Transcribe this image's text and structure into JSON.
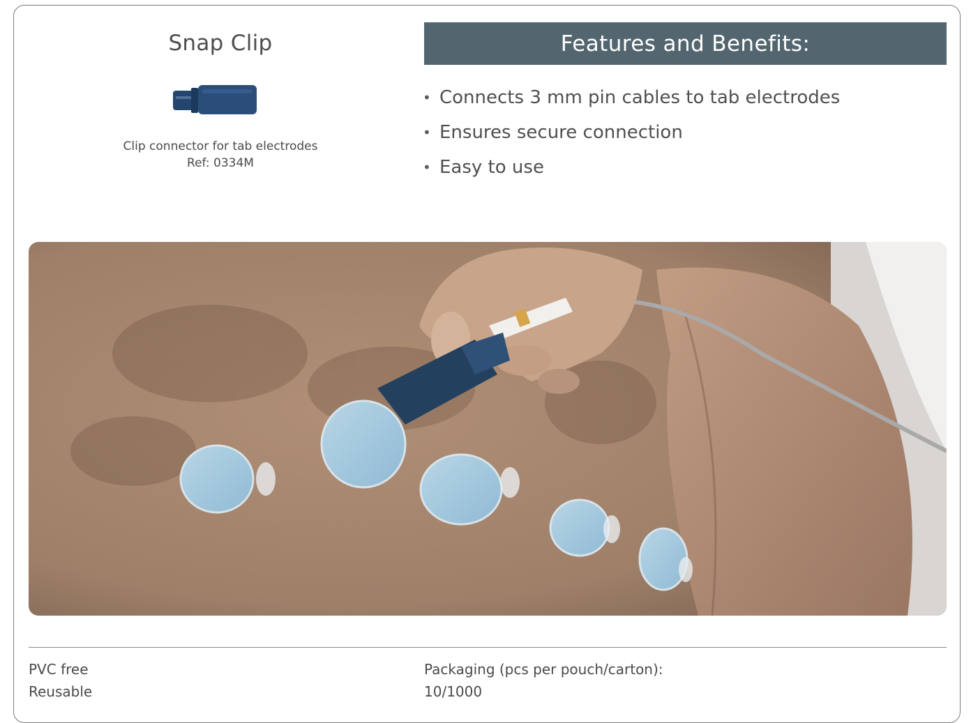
{
  "product": {
    "title": "Snap Clip",
    "image_icon": "blue-snap-clip-connector",
    "description": "Clip connector for tab electrodes",
    "reference": "Ref: 0334M"
  },
  "features": {
    "header": "Features and Benefits:",
    "header_color": "#536670",
    "items": [
      "Connects 3 mm pin cables to tab electrodes",
      "Ensures secure connection",
      "Easy to use"
    ]
  },
  "footer": {
    "left": [
      "PVC free",
      "Reusable"
    ],
    "packaging_label": "Packaging (pcs per pouch/carton):",
    "packaging_value": "10/1000"
  }
}
